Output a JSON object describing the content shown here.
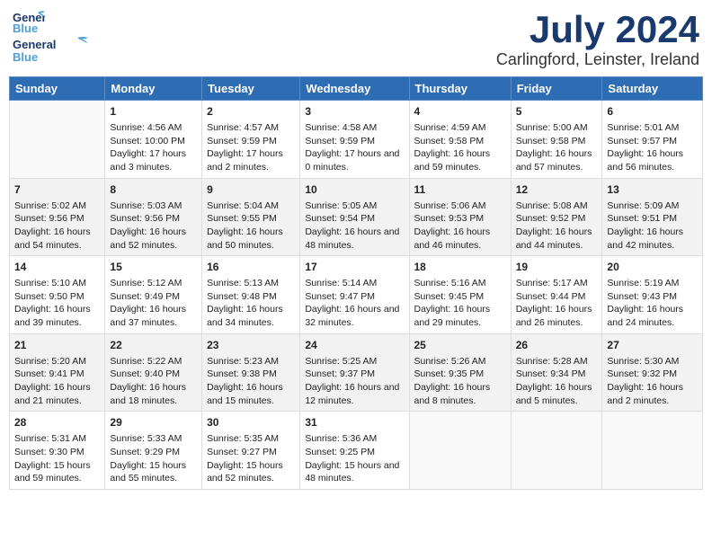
{
  "logo": {
    "line1": "General",
    "line2": "Blue"
  },
  "title": "July 2024",
  "location": "Carlingford, Leinster, Ireland",
  "days_of_week": [
    "Sunday",
    "Monday",
    "Tuesday",
    "Wednesday",
    "Thursday",
    "Friday",
    "Saturday"
  ],
  "weeks": [
    [
      {
        "num": "",
        "sunrise": "",
        "sunset": "",
        "daylight": "",
        "empty": true
      },
      {
        "num": "1",
        "sunrise": "Sunrise: 4:56 AM",
        "sunset": "Sunset: 10:00 PM",
        "daylight": "Daylight: 17 hours and 3 minutes."
      },
      {
        "num": "2",
        "sunrise": "Sunrise: 4:57 AM",
        "sunset": "Sunset: 9:59 PM",
        "daylight": "Daylight: 17 hours and 2 minutes."
      },
      {
        "num": "3",
        "sunrise": "Sunrise: 4:58 AM",
        "sunset": "Sunset: 9:59 PM",
        "daylight": "Daylight: 17 hours and 0 minutes."
      },
      {
        "num": "4",
        "sunrise": "Sunrise: 4:59 AM",
        "sunset": "Sunset: 9:58 PM",
        "daylight": "Daylight: 16 hours and 59 minutes."
      },
      {
        "num": "5",
        "sunrise": "Sunrise: 5:00 AM",
        "sunset": "Sunset: 9:58 PM",
        "daylight": "Daylight: 16 hours and 57 minutes."
      },
      {
        "num": "6",
        "sunrise": "Sunrise: 5:01 AM",
        "sunset": "Sunset: 9:57 PM",
        "daylight": "Daylight: 16 hours and 56 minutes."
      }
    ],
    [
      {
        "num": "7",
        "sunrise": "Sunrise: 5:02 AM",
        "sunset": "Sunset: 9:56 PM",
        "daylight": "Daylight: 16 hours and 54 minutes."
      },
      {
        "num": "8",
        "sunrise": "Sunrise: 5:03 AM",
        "sunset": "Sunset: 9:56 PM",
        "daylight": "Daylight: 16 hours and 52 minutes."
      },
      {
        "num": "9",
        "sunrise": "Sunrise: 5:04 AM",
        "sunset": "Sunset: 9:55 PM",
        "daylight": "Daylight: 16 hours and 50 minutes."
      },
      {
        "num": "10",
        "sunrise": "Sunrise: 5:05 AM",
        "sunset": "Sunset: 9:54 PM",
        "daylight": "Daylight: 16 hours and 48 minutes."
      },
      {
        "num": "11",
        "sunrise": "Sunrise: 5:06 AM",
        "sunset": "Sunset: 9:53 PM",
        "daylight": "Daylight: 16 hours and 46 minutes."
      },
      {
        "num": "12",
        "sunrise": "Sunrise: 5:08 AM",
        "sunset": "Sunset: 9:52 PM",
        "daylight": "Daylight: 16 hours and 44 minutes."
      },
      {
        "num": "13",
        "sunrise": "Sunrise: 5:09 AM",
        "sunset": "Sunset: 9:51 PM",
        "daylight": "Daylight: 16 hours and 42 minutes."
      }
    ],
    [
      {
        "num": "14",
        "sunrise": "Sunrise: 5:10 AM",
        "sunset": "Sunset: 9:50 PM",
        "daylight": "Daylight: 16 hours and 39 minutes."
      },
      {
        "num": "15",
        "sunrise": "Sunrise: 5:12 AM",
        "sunset": "Sunset: 9:49 PM",
        "daylight": "Daylight: 16 hours and 37 minutes."
      },
      {
        "num": "16",
        "sunrise": "Sunrise: 5:13 AM",
        "sunset": "Sunset: 9:48 PM",
        "daylight": "Daylight: 16 hours and 34 minutes."
      },
      {
        "num": "17",
        "sunrise": "Sunrise: 5:14 AM",
        "sunset": "Sunset: 9:47 PM",
        "daylight": "Daylight: 16 hours and 32 minutes."
      },
      {
        "num": "18",
        "sunrise": "Sunrise: 5:16 AM",
        "sunset": "Sunset: 9:45 PM",
        "daylight": "Daylight: 16 hours and 29 minutes."
      },
      {
        "num": "19",
        "sunrise": "Sunrise: 5:17 AM",
        "sunset": "Sunset: 9:44 PM",
        "daylight": "Daylight: 16 hours and 26 minutes."
      },
      {
        "num": "20",
        "sunrise": "Sunrise: 5:19 AM",
        "sunset": "Sunset: 9:43 PM",
        "daylight": "Daylight: 16 hours and 24 minutes."
      }
    ],
    [
      {
        "num": "21",
        "sunrise": "Sunrise: 5:20 AM",
        "sunset": "Sunset: 9:41 PM",
        "daylight": "Daylight: 16 hours and 21 minutes."
      },
      {
        "num": "22",
        "sunrise": "Sunrise: 5:22 AM",
        "sunset": "Sunset: 9:40 PM",
        "daylight": "Daylight: 16 hours and 18 minutes."
      },
      {
        "num": "23",
        "sunrise": "Sunrise: 5:23 AM",
        "sunset": "Sunset: 9:38 PM",
        "daylight": "Daylight: 16 hours and 15 minutes."
      },
      {
        "num": "24",
        "sunrise": "Sunrise: 5:25 AM",
        "sunset": "Sunset: 9:37 PM",
        "daylight": "Daylight: 16 hours and 12 minutes."
      },
      {
        "num": "25",
        "sunrise": "Sunrise: 5:26 AM",
        "sunset": "Sunset: 9:35 PM",
        "daylight": "Daylight: 16 hours and 8 minutes."
      },
      {
        "num": "26",
        "sunrise": "Sunrise: 5:28 AM",
        "sunset": "Sunset: 9:34 PM",
        "daylight": "Daylight: 16 hours and 5 minutes."
      },
      {
        "num": "27",
        "sunrise": "Sunrise: 5:30 AM",
        "sunset": "Sunset: 9:32 PM",
        "daylight": "Daylight: 16 hours and 2 minutes."
      }
    ],
    [
      {
        "num": "28",
        "sunrise": "Sunrise: 5:31 AM",
        "sunset": "Sunset: 9:30 PM",
        "daylight": "Daylight: 15 hours and 59 minutes."
      },
      {
        "num": "29",
        "sunrise": "Sunrise: 5:33 AM",
        "sunset": "Sunset: 9:29 PM",
        "daylight": "Daylight: 15 hours and 55 minutes."
      },
      {
        "num": "30",
        "sunrise": "Sunrise: 5:35 AM",
        "sunset": "Sunset: 9:27 PM",
        "daylight": "Daylight: 15 hours and 52 minutes."
      },
      {
        "num": "31",
        "sunrise": "Sunrise: 5:36 AM",
        "sunset": "Sunset: 9:25 PM",
        "daylight": "Daylight: 15 hours and 48 minutes."
      },
      {
        "num": "",
        "sunrise": "",
        "sunset": "",
        "daylight": "",
        "empty": true
      },
      {
        "num": "",
        "sunrise": "",
        "sunset": "",
        "daylight": "",
        "empty": true
      },
      {
        "num": "",
        "sunrise": "",
        "sunset": "",
        "daylight": "",
        "empty": true
      }
    ]
  ]
}
